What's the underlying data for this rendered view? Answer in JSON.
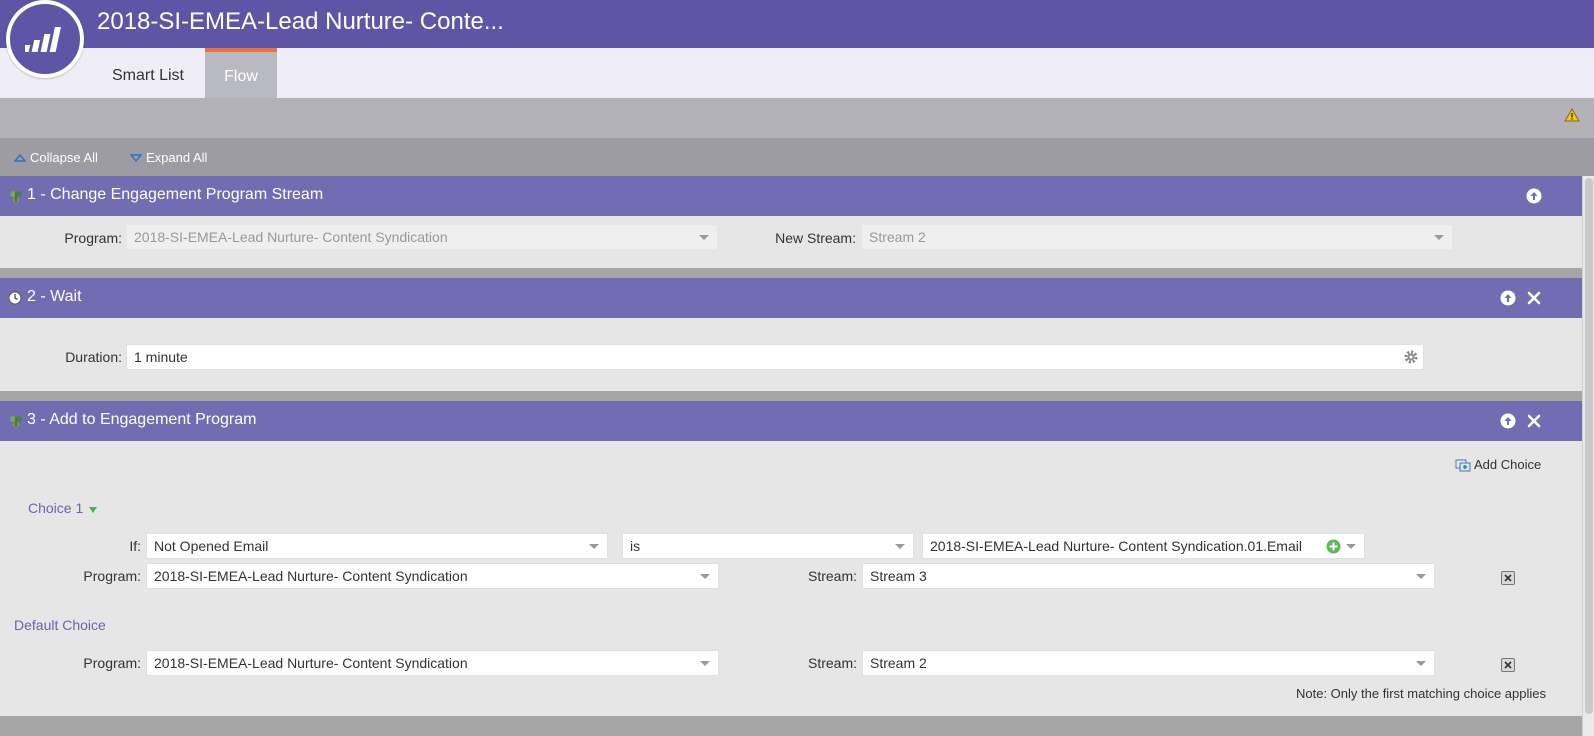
{
  "app": {
    "title": "2018-SI-EMEA-Lead Nurture- Conte...",
    "logo_icon": "marketo-logo-icon"
  },
  "tabs": [
    {
      "label": "Smart List",
      "active": false
    },
    {
      "label": "Flow",
      "active": true
    }
  ],
  "toolbar": {
    "collapse_label": "Collapse All",
    "expand_label": "Expand All"
  },
  "steps": [
    {
      "title": "1 - Change Engagement Program Stream",
      "icon": "engagement-program-icon",
      "program_label": "Program:",
      "program_value": "2018-SI-EMEA-Lead Nurture- Content Syndication",
      "stream_label": "New Stream:",
      "stream_value": "Stream 2"
    },
    {
      "title": "2 - Wait",
      "icon": "clock-icon",
      "duration_label": "Duration:",
      "duration_value": "1 minute"
    },
    {
      "title": "3 - Add to Engagement Program",
      "icon": "engagement-program-icon",
      "add_choice_label": "Add Choice",
      "choice1": {
        "label": "Choice 1",
        "if_label": "If:",
        "if_value": "Not Opened Email",
        "operator_value": "is",
        "email_value": "2018-SI-EMEA-Lead Nurture- Content Syndication.01.Email",
        "program_label": "Program:",
        "program_value": "2018-SI-EMEA-Lead Nurture- Content Syndication",
        "stream_label": "Stream:",
        "stream_value": "Stream 3"
      },
      "default_choice": {
        "label": "Default Choice",
        "program_label": "Program:",
        "program_value": "2018-SI-EMEA-Lead Nurture- Content Syndication",
        "stream_label": "Stream:",
        "stream_value": "Stream 2"
      },
      "note": "Note: Only the first matching choice applies"
    }
  ],
  "colors": {
    "brand_purple": "#5f55a7",
    "step_header": "#726cb3",
    "tab_accent": "#e9733a",
    "link": "#6c63b0",
    "add_green": "#5cb85c"
  }
}
